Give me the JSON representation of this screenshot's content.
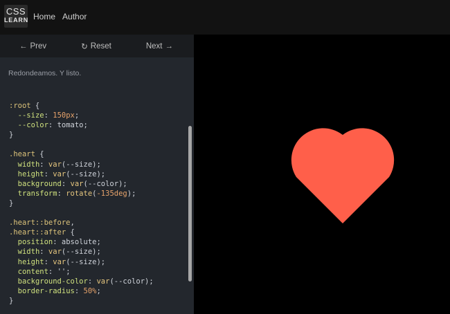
{
  "logo": {
    "line1": "CSS",
    "line2": "LEARN"
  },
  "nav": {
    "home": "Home",
    "author": "Author"
  },
  "controls": {
    "prev": "Prev",
    "reset": "Reset",
    "next": "Next"
  },
  "description": "Redondeamos. Y listo.",
  "code_lines": [
    ":root {",
    "  --size: 150px;",
    "  --color: tomato;",
    "}",
    "",
    ".heart {",
    "  width: var(--size);",
    "  height: var(--size);",
    "  background: var(--color);",
    "  transform: rotate(-135deg);",
    "}",
    "",
    ".heart::before,",
    ".heart::after {",
    "  position: absolute;",
    "  width: var(--size);",
    "  height: var(--size);",
    "  content: '';",
    "  background-color: var(--color);",
    "  border-radius: 50%;",
    "}"
  ],
  "colors": {
    "heart": "#ff5f4a",
    "editor_bg": "#23272d",
    "topbar_bg": "#121212",
    "preview_bg": "#000000"
  },
  "icons": {
    "prev": "arrow-left-icon",
    "reset": "reset-icon",
    "next": "arrow-right-icon"
  }
}
